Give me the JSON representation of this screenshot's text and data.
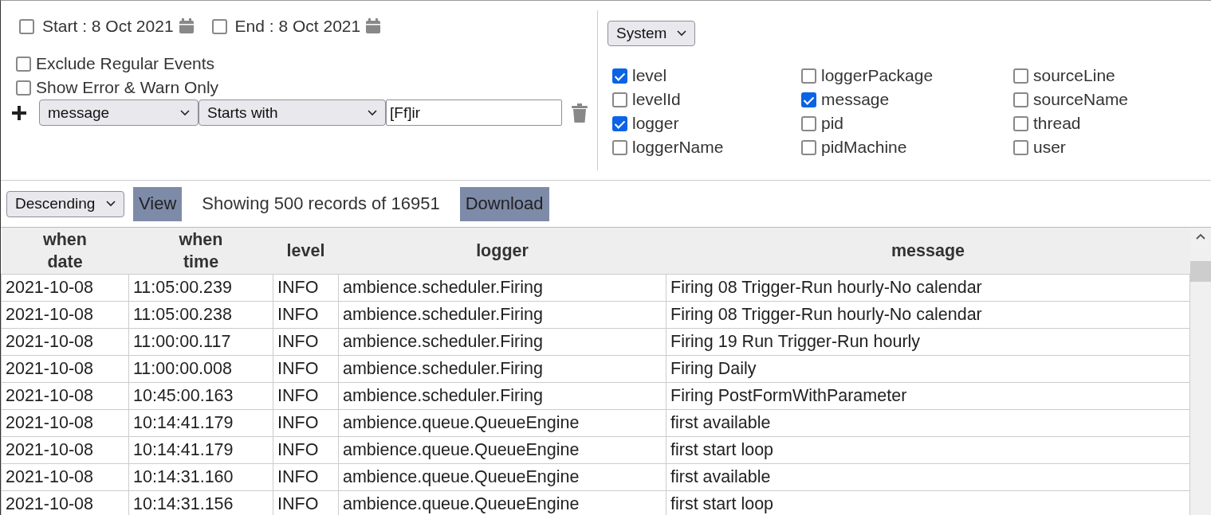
{
  "date_range": [
    {
      "label": "Start : 8 Oct 2021",
      "checked": false
    },
    {
      "label": "End : 8 Oct 2021",
      "checked": false
    }
  ],
  "options": [
    {
      "label": "Exclude Regular Events",
      "checked": false
    },
    {
      "label": "Show Error & Warn Only",
      "checked": false
    }
  ],
  "filter": {
    "field": "message",
    "operator": "Starts with",
    "value": "[Ff]ir"
  },
  "source_select": "System",
  "fields": [
    {
      "label": "level",
      "checked": true
    },
    {
      "label": "levelId",
      "checked": false
    },
    {
      "label": "logger",
      "checked": true
    },
    {
      "label": "loggerName",
      "checked": false
    },
    {
      "label": "loggerPackage",
      "checked": false
    },
    {
      "label": "message",
      "checked": true
    },
    {
      "label": "pid",
      "checked": false
    },
    {
      "label": "pidMachine",
      "checked": false
    },
    {
      "label": "sourceLine",
      "checked": false
    },
    {
      "label": "sourceName",
      "checked": false
    },
    {
      "label": "thread",
      "checked": false
    },
    {
      "label": "user",
      "checked": false
    }
  ],
  "toolbar": {
    "order": "Descending",
    "view_button": "View",
    "status": "Showing 500 records of 16951",
    "download_button": "Download"
  },
  "table": {
    "columns": [
      "when\ndate",
      "when\ntime",
      "level",
      "logger",
      "message"
    ],
    "rows": [
      [
        "2021-10-08",
        "11:05:00.239",
        "INFO",
        "ambience.scheduler.Firing",
        "Firing 08 Trigger-Run hourly-No calendar"
      ],
      [
        "2021-10-08",
        "11:05:00.238",
        "INFO",
        "ambience.scheduler.Firing",
        "Firing 08 Trigger-Run hourly-No calendar"
      ],
      [
        "2021-10-08",
        "11:00:00.117",
        "INFO",
        "ambience.scheduler.Firing",
        "Firing 19 Run Trigger-Run hourly"
      ],
      [
        "2021-10-08",
        "11:00:00.008",
        "INFO",
        "ambience.scheduler.Firing",
        "Firing Daily"
      ],
      [
        "2021-10-08",
        "10:45:00.163",
        "INFO",
        "ambience.scheduler.Firing",
        "Firing PostFormWithParameter"
      ],
      [
        "2021-10-08",
        "10:14:41.179",
        "INFO",
        "ambience.queue.QueueEngine",
        "first available"
      ],
      [
        "2021-10-08",
        "10:14:41.179",
        "INFO",
        "ambience.queue.QueueEngine",
        "first start loop"
      ],
      [
        "2021-10-08",
        "10:14:31.160",
        "INFO",
        "ambience.queue.QueueEngine",
        "first available"
      ],
      [
        "2021-10-08",
        "10:14:31.156",
        "INFO",
        "ambience.queue.QueueEngine",
        "first start loop"
      ]
    ]
  }
}
